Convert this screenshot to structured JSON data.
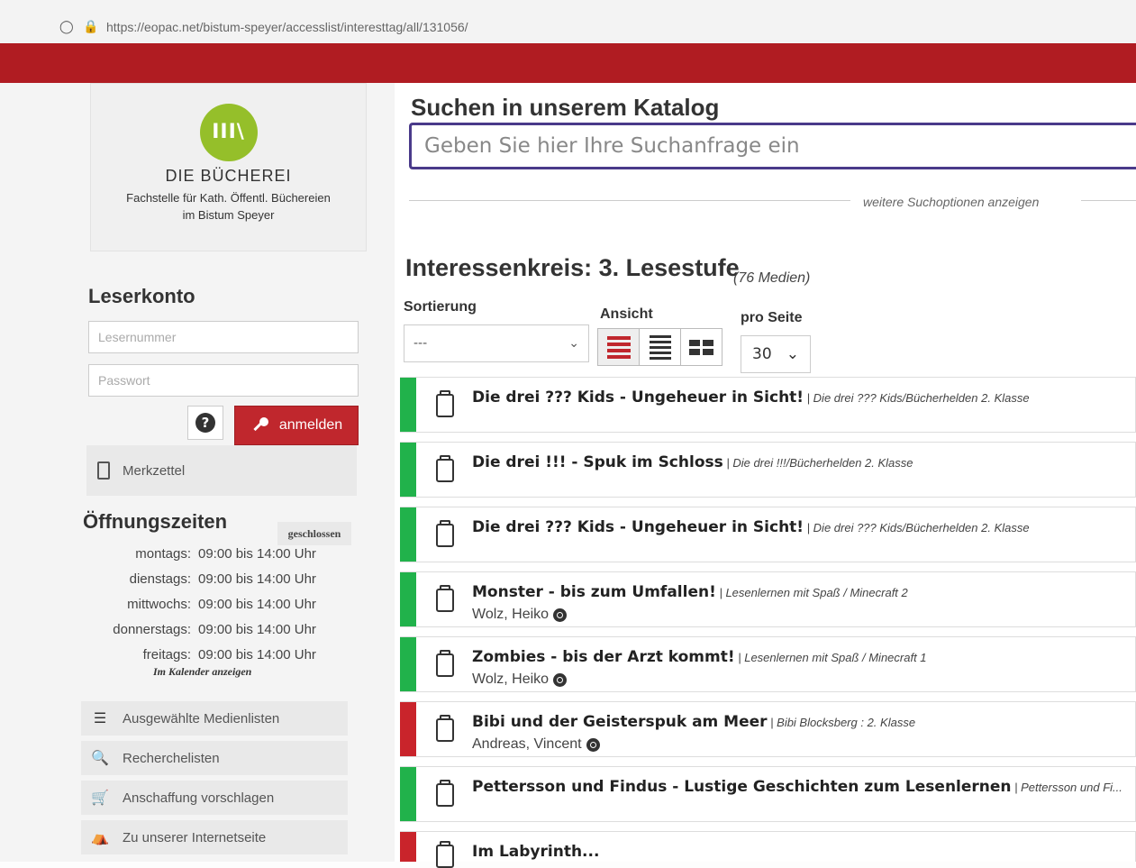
{
  "browser": {
    "url": "https://eopac.net/bistum-speyer/accesslist/interesttag/all/131056/"
  },
  "logo": {
    "mark": "III\\",
    "title": "DIE BÜCHEREI",
    "subtitle_line1": "Fachstelle für Kath. Öffentl. Büchereien",
    "subtitle_line2": "im Bistum Speyer"
  },
  "account": {
    "heading": "Leserkonto",
    "reader_placeholder": "Lesernummer",
    "password_placeholder": "Passwort",
    "help_label": "?",
    "login_label": "anmelden",
    "memo_label": "Merkzettel"
  },
  "hours": {
    "heading": "Öffnungszeiten",
    "status": "geschlossen",
    "rows": [
      {
        "day": "montags:",
        "time": "09:00 bis 14:00 Uhr"
      },
      {
        "day": "dienstags:",
        "time": "09:00 bis 14:00 Uhr"
      },
      {
        "day": "mittwochs:",
        "time": "09:00 bis 14:00 Uhr"
      },
      {
        "day": "donnerstags:",
        "time": "09:00 bis 14:00 Uhr"
      },
      {
        "day": "freitags:",
        "time": "09:00 bis 14:00 Uhr"
      }
    ],
    "calendar_link": "Im Kalender anzeigen"
  },
  "sidebar_links": [
    {
      "label": "Ausgewählte Medienlisten",
      "icon": "list-icon"
    },
    {
      "label": "Recherchelisten",
      "icon": "search-list-icon"
    },
    {
      "label": "Anschaffung vorschlagen",
      "icon": "cart-icon"
    },
    {
      "label": "Zu unserer Internetseite",
      "icon": "store-icon"
    }
  ],
  "search": {
    "heading": "Suchen in unserem Katalog",
    "placeholder": "Geben Sie hier Ihre Suchanfrage ein",
    "more_options": "weitere Suchoptionen anzeigen"
  },
  "results": {
    "title": "Interessenkreis: 3. Lesestufe",
    "count": "(76 Medien)",
    "sort_label": "Sortierung",
    "sort_value": "---",
    "view_label": "Ansicht",
    "perpage_label": "pro Seite",
    "perpage_value": "30",
    "items": [
      {
        "title": "Die drei ??? Kids - Ungeheuer in Sicht!",
        "series": " | Die drei ??? Kids/Bücherhelden 2. Klasse",
        "author": "",
        "status_color": "#21b24b"
      },
      {
        "title": "Die drei !!! - Spuk im Schloss",
        "series": " | Die drei !!!/Bücherhelden 2. Klasse",
        "author": "",
        "status_color": "#21b24b"
      },
      {
        "title": "Die drei ??? Kids - Ungeheuer in Sicht!",
        "series": " | Die drei ??? Kids/Bücherhelden 2. Klasse",
        "author": "",
        "status_color": "#21b24b"
      },
      {
        "title": "Monster - bis zum Umfallen!",
        "series": " | Lesenlernen mit Spaß / Minecraft 2",
        "author": "Wolz, Heiko",
        "status_color": "#21b24b"
      },
      {
        "title": "Zombies - bis der Arzt kommt!",
        "series": " | Lesenlernen mit Spaß / Minecraft 1",
        "author": "Wolz, Heiko",
        "status_color": "#21b24b"
      },
      {
        "title": "Bibi und der Geisterspuk am Meer",
        "series": " | Bibi Blocksberg : 2. Klasse",
        "author": "Andreas, Vincent",
        "status_color": "#c9242b"
      },
      {
        "title": "Pettersson und Findus - Lustige Geschichten zum Lesenlernen",
        "series": " | Pettersson und Fi...",
        "author": "",
        "status_color": "#21b24b"
      },
      {
        "title": "Im Labyrinth...",
        "series": "",
        "author": "",
        "status_color": "#c9242b"
      }
    ]
  }
}
